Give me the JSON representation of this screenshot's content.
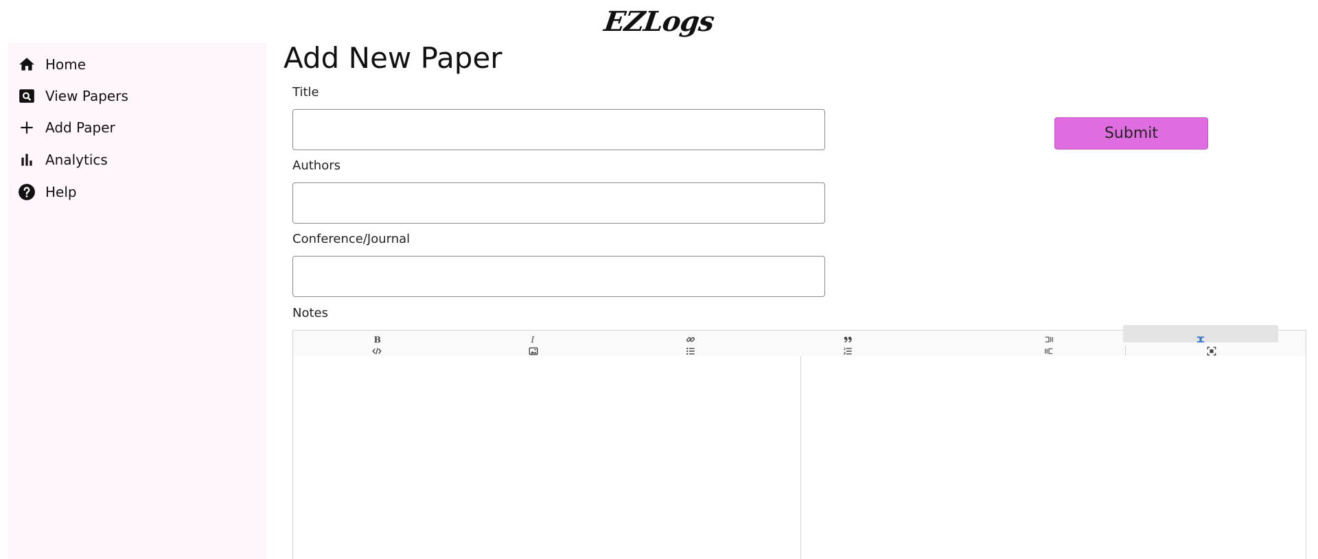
{
  "app": {
    "logo": "EZLogs"
  },
  "sidebar": {
    "items": [
      {
        "label": "Home",
        "icon": "home-icon"
      },
      {
        "label": "View Papers",
        "icon": "search-box-icon"
      },
      {
        "label": "Add Paper",
        "icon": "plus-icon"
      },
      {
        "label": "Analytics",
        "icon": "bar-chart-icon"
      },
      {
        "label": "Help",
        "icon": "help-circle-icon"
      }
    ]
  },
  "main": {
    "title": "Add New Paper",
    "fields": {
      "title": {
        "label": "Title",
        "value": ""
      },
      "authors": {
        "label": "Authors",
        "value": ""
      },
      "venue": {
        "label": "Conference/Journal",
        "value": ""
      },
      "notes": {
        "label": "Notes"
      }
    },
    "submit_label": "Submit"
  },
  "editor": {
    "toolbar": [
      "bold-icon",
      "italic-icon",
      "link-icon",
      "quote-icon",
      "side-by-side-icon",
      "split-view-icon",
      "code-icon",
      "image-icon",
      "unordered-list-icon",
      "ordered-list-icon",
      "preview-icon",
      "fullscreen-icon"
    ],
    "active_tool": "split-view-icon"
  },
  "colors": {
    "sidebar_bg": "#fff6fd",
    "submit_bg": "#e06de0",
    "active_tool": "#1565c0"
  }
}
